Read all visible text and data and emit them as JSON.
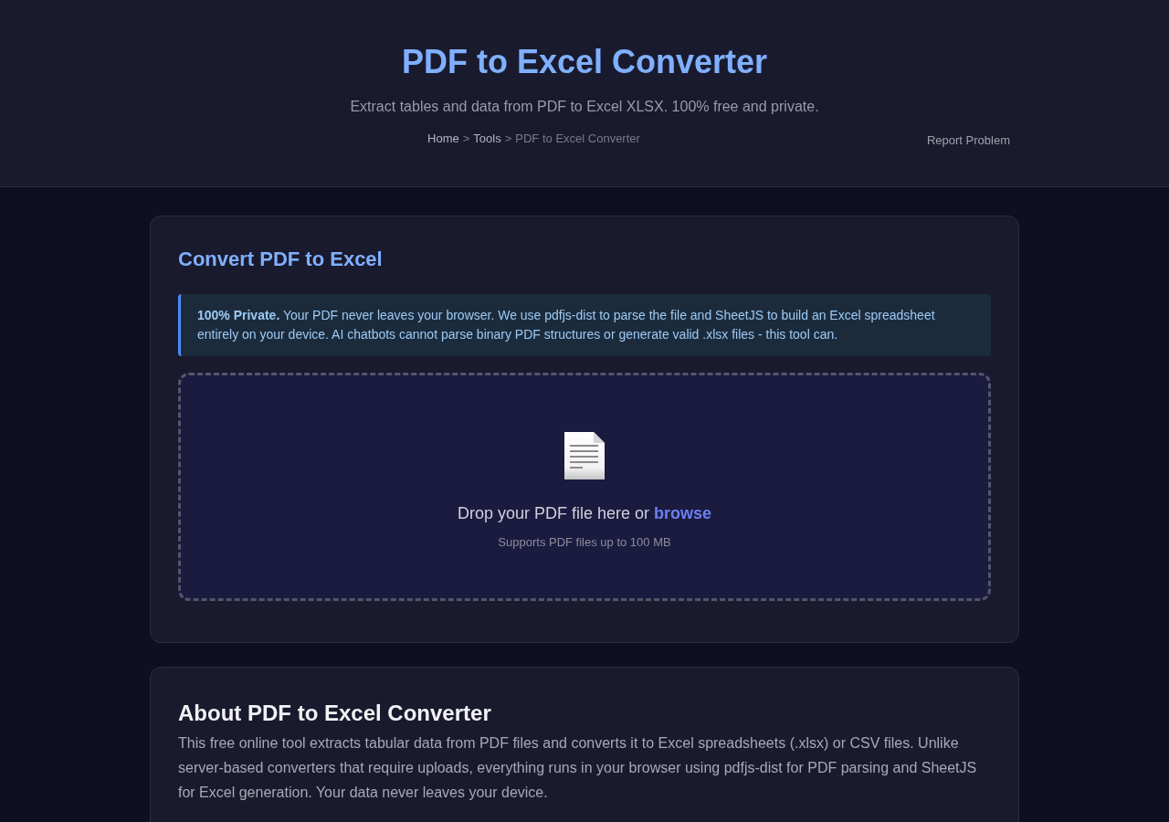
{
  "header": {
    "title": "PDF to Excel Converter",
    "subtitle": "Extract tables and data from PDF to Excel XLSX. 100% free and private.",
    "breadcrumb": [
      {
        "label": "Home",
        "kind": "link"
      },
      {
        "label": ">",
        "kind": "separator"
      },
      {
        "label": "Tools",
        "kind": "link"
      },
      {
        "label": ">",
        "kind": "separator"
      },
      {
        "label": "PDF to Excel Converter",
        "kind": "current"
      }
    ],
    "report_link": "Report Problem"
  },
  "converter": {
    "heading": "Convert PDF to Excel",
    "notice": "**100% Private.** Your PDF never leaves your browser. We use pdfjs-dist to parse the file and SheetJS to build an Excel spreadsheet entirely on your device. AI chatbots cannot parse binary PDF structures or generate valid .xlsx files - this tool can.",
    "dropzone": {
      "text": "Drop your PDF file here or",
      "link": "browse",
      "hint": "Supports PDF files up to 100 MB"
    }
  },
  "about": {
    "heading": "About PDF to Excel Converter",
    "text": "This free online tool extracts tabular data from PDF files and converts it to Excel spreadsheets (.xlsx) or CSV files. Unlike server-based converters that require uploads, everything runs in your browser using pdfjs-dist for PDF parsing and SheetJS for Excel generation. Your data never leaves your device."
  }
}
